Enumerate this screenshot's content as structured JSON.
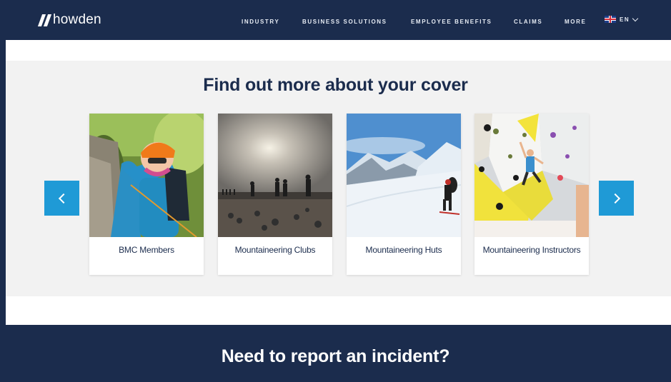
{
  "header": {
    "logo_text": "howden",
    "nav": [
      "INDUSTRY",
      "BUSINESS SOLUTIONS",
      "EMPLOYEE BENEFITS",
      "CLAIMS",
      "MORE"
    ],
    "language": "EN"
  },
  "cover": {
    "title": "Find out more about your cover",
    "cards": [
      {
        "label": "BMC Members"
      },
      {
        "label": "Mountaineering Clubs"
      },
      {
        "label": "Mountaineering Huts"
      },
      {
        "label": "Mountaineering Instructors"
      }
    ]
  },
  "incident": {
    "title": "Need to report an incident?"
  },
  "colors": {
    "navy": "#1b2c4d",
    "accent": "#1f9ad6",
    "section_bg": "#f2f2f2"
  }
}
